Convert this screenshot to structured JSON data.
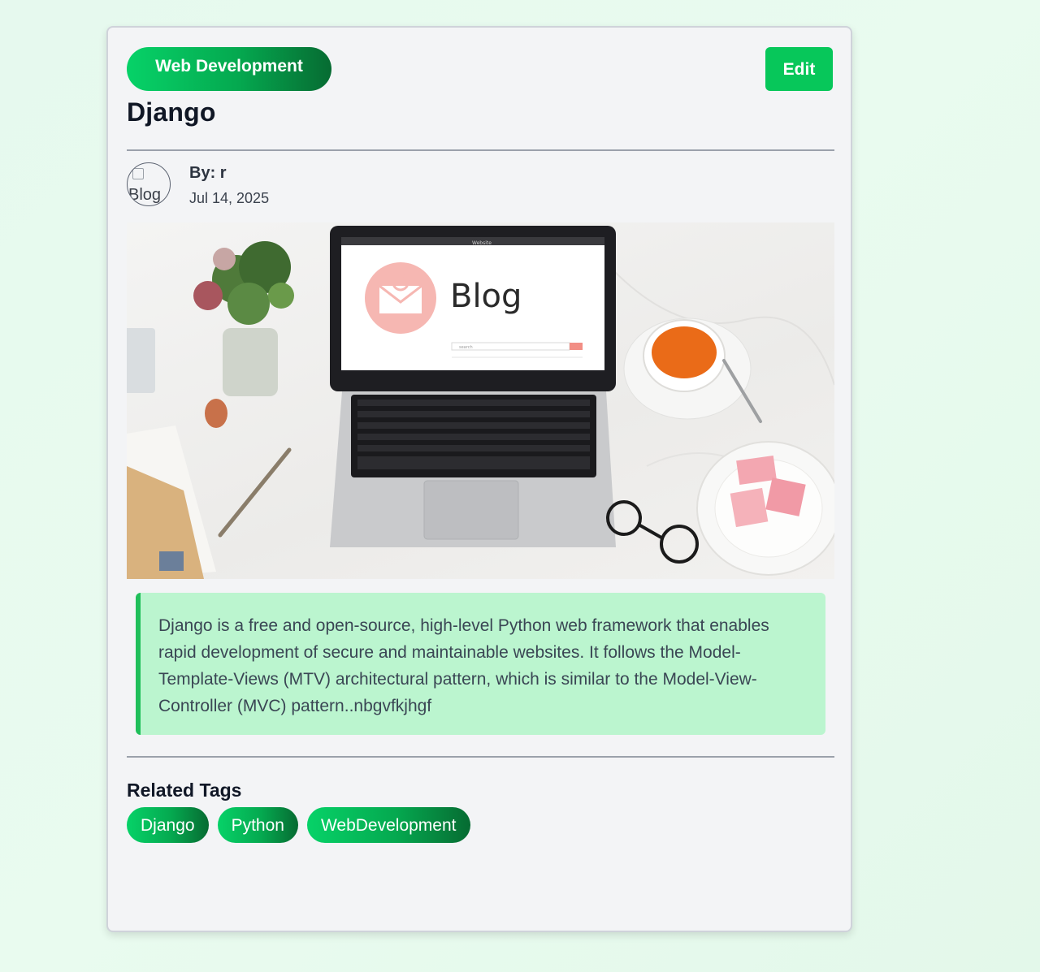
{
  "post": {
    "category": "Web Development",
    "edit_label": "Edit",
    "title": "Django",
    "author": "By: r",
    "date": "Jul 14, 2025",
    "avatar_alt": "Blog",
    "hero_image": {
      "screen_text": "Blog",
      "search_placeholder": "search",
      "browser_title": "Website"
    },
    "excerpt": "Django is a free and open-source, high-level Python web framework that enables rapid development of secure and maintainable websites. It follows the Model-Template-Views (MTV) architectural pattern, which is similar to the Model-View-Controller (MVC) pattern..nbgvfkjhgf"
  },
  "related_tags": {
    "heading": "Related Tags",
    "items": [
      "Django",
      "Python",
      "WebDevelopment"
    ]
  },
  "colors": {
    "accent_green": "#07c75a",
    "excerpt_bg": "#bbf5cf",
    "excerpt_border": "#1fbf5a",
    "title": "#101725"
  }
}
